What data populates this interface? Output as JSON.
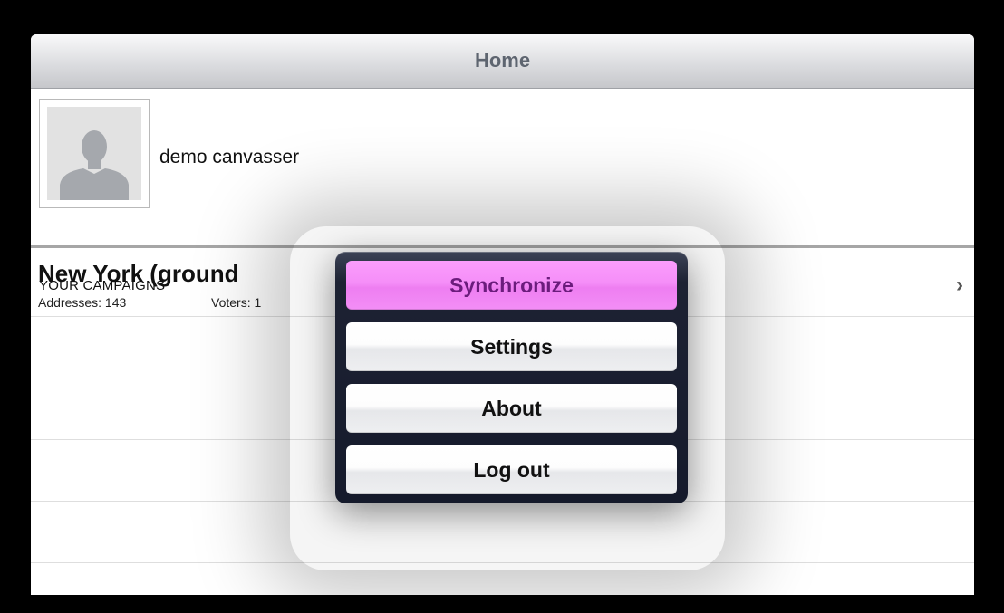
{
  "navbar": {
    "title": "Home"
  },
  "profile": {
    "name": "demo canvasser",
    "avatar_icon": "person-silhouette-icon"
  },
  "campaigns": {
    "header": "YOUR CAMPAIGNS",
    "items": [
      {
        "name": "New York (ground",
        "addresses": "Addresses: 143",
        "voters": "Voters: 1",
        "chevron": "›"
      }
    ]
  },
  "menu": {
    "items": [
      {
        "label": "Synchronize",
        "active": true
      },
      {
        "label": "Settings"
      },
      {
        "label": "About"
      },
      {
        "label": "Log out"
      }
    ],
    "active_color": "#f58ef8"
  }
}
